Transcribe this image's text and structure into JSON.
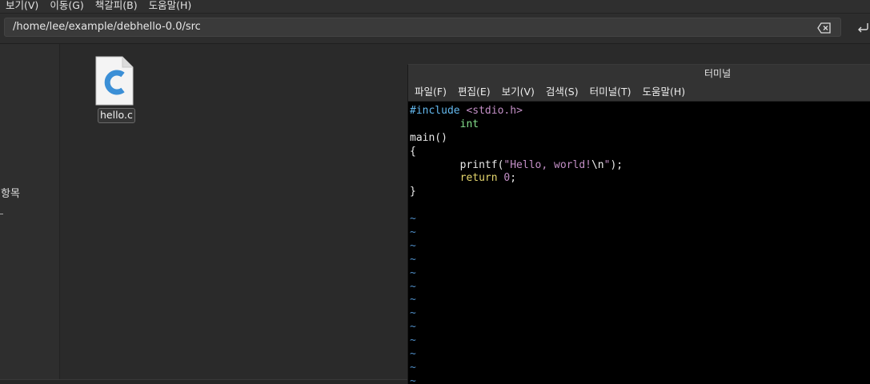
{
  "file_manager": {
    "menu": [
      "보기(V)",
      "이동(G)",
      "책갈피(B)",
      "도움말(H)"
    ],
    "location": "/home/lee/example/debhello-0.0/src",
    "sidebar_label": "항목",
    "files": [
      {
        "name": "hello.c",
        "icon": "c-source-file-icon"
      }
    ]
  },
  "terminal": {
    "title": "터미널",
    "menu": [
      "파일(F)",
      "편집(E)",
      "보기(V)",
      "검색(S)",
      "터미널(T)",
      "도움말(H)"
    ],
    "lines": [
      [
        {
          "t": "#include ",
          "c": "pre"
        },
        {
          "t": "<stdio.h>",
          "c": "inc"
        }
      ],
      [
        {
          "t": "        ",
          "c": "norm"
        },
        {
          "t": "int",
          "c": "type"
        }
      ],
      [
        {
          "t": "main()",
          "c": "norm"
        }
      ],
      [
        {
          "t": "{",
          "c": "norm"
        }
      ],
      [
        {
          "t": "        printf(",
          "c": "norm"
        },
        {
          "t": "\"Hello, world!",
          "c": "str"
        },
        {
          "t": "\\n",
          "c": "esc"
        },
        {
          "t": "\"",
          "c": "str"
        },
        {
          "t": ");",
          "c": "norm"
        }
      ],
      [
        {
          "t": "        ",
          "c": "norm"
        },
        {
          "t": "return",
          "c": "kw"
        },
        {
          "t": " ",
          "c": "norm"
        },
        {
          "t": "0",
          "c": "num"
        },
        {
          "t": ";",
          "c": "norm"
        }
      ],
      [
        {
          "t": "}",
          "c": "norm"
        }
      ],
      [
        {
          "t": "",
          "c": "norm"
        }
      ],
      [
        {
          "t": "~",
          "c": "tilde"
        }
      ],
      [
        {
          "t": "~",
          "c": "tilde"
        }
      ],
      [
        {
          "t": "~",
          "c": "tilde"
        }
      ],
      [
        {
          "t": "~",
          "c": "tilde"
        }
      ],
      [
        {
          "t": "~",
          "c": "tilde"
        }
      ],
      [
        {
          "t": "~",
          "c": "tilde"
        }
      ],
      [
        {
          "t": "~",
          "c": "tilde"
        }
      ],
      [
        {
          "t": "~",
          "c": "tilde"
        }
      ],
      [
        {
          "t": "~",
          "c": "tilde"
        }
      ],
      [
        {
          "t": "~",
          "c": "tilde"
        }
      ],
      [
        {
          "t": "~",
          "c": "tilde"
        }
      ],
      [
        {
          "t": "~",
          "c": "tilde"
        }
      ],
      [
        {
          "t": "~",
          "c": "tilde"
        }
      ]
    ]
  },
  "colors": {
    "syntax_preprocessor": "#64b9ef",
    "syntax_include": "#c38fc6",
    "syntax_type": "#85e08d",
    "syntax_keyword": "#e6d86e",
    "syntax_string": "#c38fc6",
    "vim_tilde": "#4f8ec7",
    "c_icon_blue": "#3b8fd6"
  }
}
